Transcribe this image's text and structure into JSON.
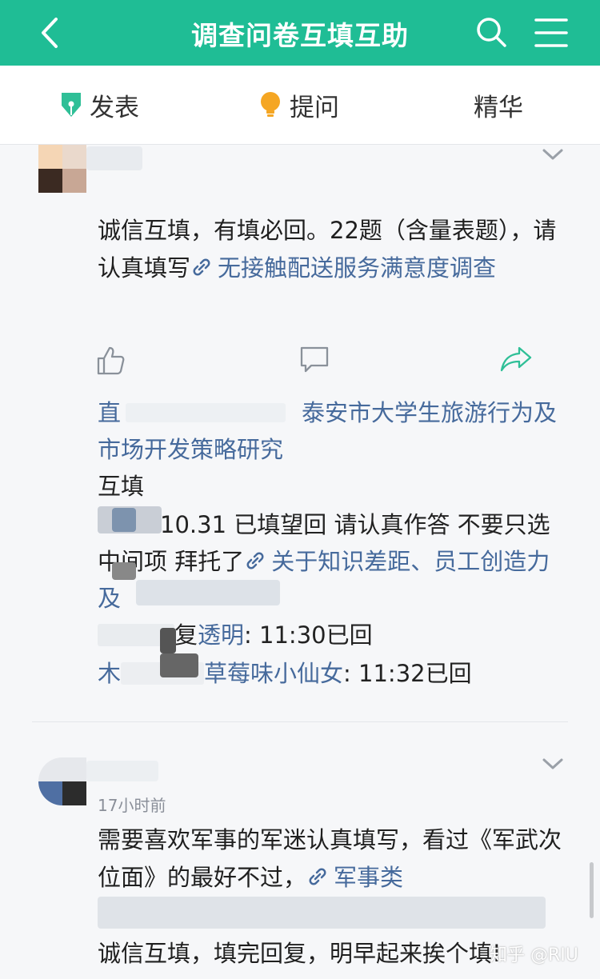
{
  "topbar": {
    "title": "调查问卷互填互助",
    "icons": {
      "back": "back-arrow-icon",
      "search": "search-icon",
      "menu": "menu-icon"
    },
    "color": "#1fbd95"
  },
  "subnav": {
    "publish": "发表",
    "ask": "提问",
    "featured": "精华"
  },
  "post1": {
    "text": "诚信互填，有填必回。22题（含量表题），请认真填写",
    "link": "无接触配送服务满意度调查",
    "replies": [
      {
        "prefix": "直",
        "link": "泰安市大学生旅游行为及市场开发策略研究",
        "suffix": "互填"
      },
      {
        "text": "10.31 已填望回 请认真作答 不要只选中间项 拜托了",
        "link": "关于知识差距、员工创造力及"
      },
      {
        "prefix": "复",
        "user": "透明",
        "msg": ": 11:30已回"
      },
      {
        "prefix": "木",
        "user": "草莓味小仙女",
        "msg": ": 11:32已回"
      }
    ]
  },
  "post2": {
    "time": "17小时前",
    "text1": "需要喜欢军事的军迷认真填写，看过《军武次位面》的最好不过，",
    "link": "军事类",
    "text2": "诚信互填，填完回复，明早起来挨个填!"
  },
  "watermark": "知乎 @RIU"
}
